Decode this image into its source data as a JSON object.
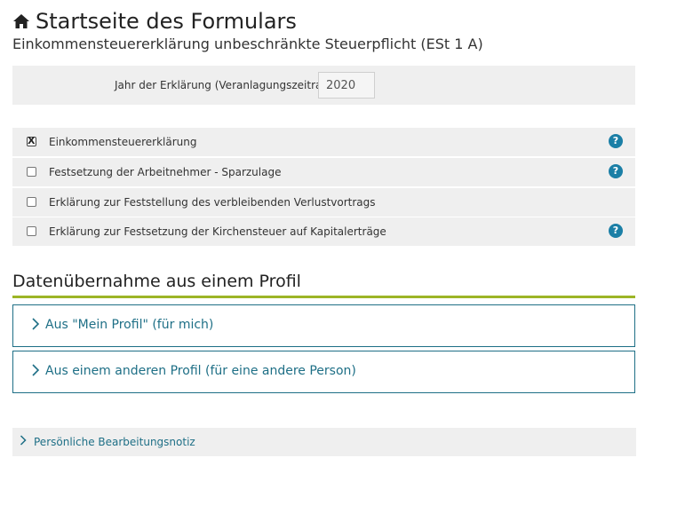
{
  "header": {
    "title": "Startseite des Formulars",
    "subtitle": "Einkommensteuererklärung unbeschränkte Steuerpflicht (ESt 1 A)"
  },
  "year": {
    "label": "Jahr der Erklärung (Veranlagungszeitraum)",
    "value": "2020"
  },
  "options": [
    {
      "label": "Einkommensteuererklärung",
      "checked": true,
      "help": true
    },
    {
      "label": "Festsetzung der Arbeitnehmer - Sparzulage",
      "checked": false,
      "help": true
    },
    {
      "label": "Erklärung zur Feststellung des verbleibenden Verlustvortrags",
      "checked": false,
      "help": false
    },
    {
      "label": "Erklärung zur Festsetzung der Kirchensteuer auf Kapitalerträge",
      "checked": false,
      "help": true
    }
  ],
  "help_glyph": "?",
  "profile_section": {
    "title": "Datenübernahme aus einem Profil",
    "items": [
      {
        "label": "Aus \"Mein Profil\" (für mich)"
      },
      {
        "label": "Aus einem anderen Profil (für eine andere Person)"
      }
    ]
  },
  "note": {
    "label": "Persönliche Bearbeitungsnotiz"
  },
  "icons": {
    "home": "home-icon",
    "chevron": "chevron-right-icon",
    "help": "help-icon"
  },
  "colors": {
    "accent": "#1e6f86",
    "help_bg": "#1b7fa6",
    "divider": "#9cb526",
    "panel": "#efefef"
  }
}
